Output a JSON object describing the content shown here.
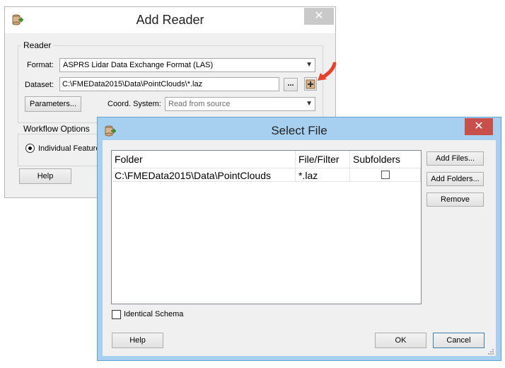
{
  "add_reader": {
    "title": "Add Reader",
    "close_glyph": "✕",
    "reader_group": "Reader",
    "format_label": "Format:",
    "format_value": "ASPRS Lidar Data Exchange Format (LAS)",
    "dataset_label": "Dataset:",
    "dataset_value": "C:\\FMEData2015\\Data\\PointClouds\\*.laz",
    "browse_label": "...",
    "parameters_label": "Parameters...",
    "coord_label": "Coord. System:",
    "coord_value": "Read from source",
    "workflow_group": "Workflow Options",
    "workflow_radio_label": "Individual Feature",
    "help_label": "Help"
  },
  "select_file": {
    "title": "Select File",
    "close_glyph": "✕",
    "columns": [
      "Folder",
      "File/Filter",
      "Subfolders"
    ],
    "rows": [
      {
        "folder": "C:\\FMEData2015\\Data\\PointClouds",
        "filter": "*.laz",
        "subfolders": false
      }
    ],
    "add_files_label": "Add Files...",
    "add_folders_label": "Add Folders...",
    "remove_label": "Remove",
    "identical_schema_label": "Identical Schema",
    "help_label": "Help",
    "ok_label": "OK",
    "cancel_label": "Cancel"
  },
  "colors": {
    "active_titlebar": "#a6cff0",
    "inactive_titlebar": "#ffffff",
    "close_active": "#c7504b",
    "arrow_accent": "#e8412a"
  }
}
